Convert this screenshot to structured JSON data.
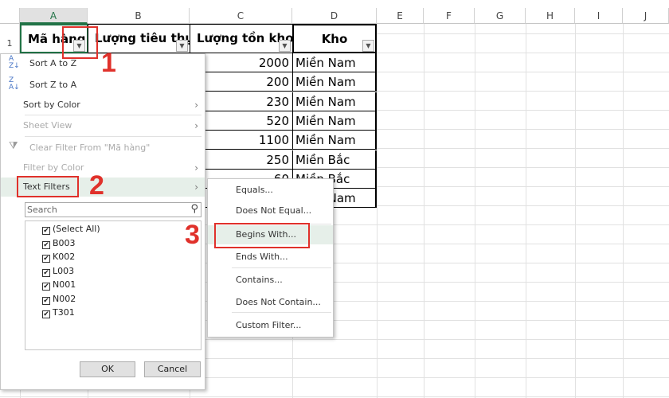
{
  "columns": [
    "A",
    "B",
    "C",
    "D",
    "E",
    "F",
    "G",
    "H",
    "I",
    "J"
  ],
  "row_numbers": [
    "1"
  ],
  "headers": {
    "a": "Mã hàng",
    "b": "Lượng tiêu thụ",
    "c": "Lượng tồn kho",
    "d": "Kho"
  },
  "rows": [
    {
      "c": "2000",
      "d": "Miền Nam"
    },
    {
      "c": "200",
      "d": "Miền Nam"
    },
    {
      "c": "230",
      "d": "Miền Nam"
    },
    {
      "c": "520",
      "d": "Miền Nam"
    },
    {
      "c": "1100",
      "d": "Miền Nam"
    },
    {
      "c": "250",
      "d": "Miền Bắc"
    },
    {
      "c": "60",
      "d": "Miền Bắc"
    },
    {
      "c": "",
      "d": "Miền Nam"
    }
  ],
  "menu": {
    "sort_az": "Sort A to Z",
    "sort_za": "Sort Z to A",
    "sort_color": "Sort by Color",
    "sheet_view": "Sheet View",
    "clear_filter": "Clear Filter From \"Mã hàng\"",
    "filter_color": "Filter by Color",
    "text_filters": "Text Filters",
    "search_placeholder": "Search",
    "items": [
      "(Select All)",
      "B003",
      "K002",
      "L003",
      "N001",
      "N002",
      "T301"
    ],
    "ok": "OK",
    "cancel": "Cancel"
  },
  "submenu": [
    "Equals...",
    "Does Not Equal...",
    "Begins With...",
    "Ends With...",
    "Contains...",
    "Does Not Contain...",
    "Custom Filter..."
  ],
  "steps": [
    "1",
    "2",
    "3"
  ],
  "colors": {
    "annotation": "#e0312b",
    "excel_green": "#217346",
    "highlight": "#e6efe9"
  }
}
